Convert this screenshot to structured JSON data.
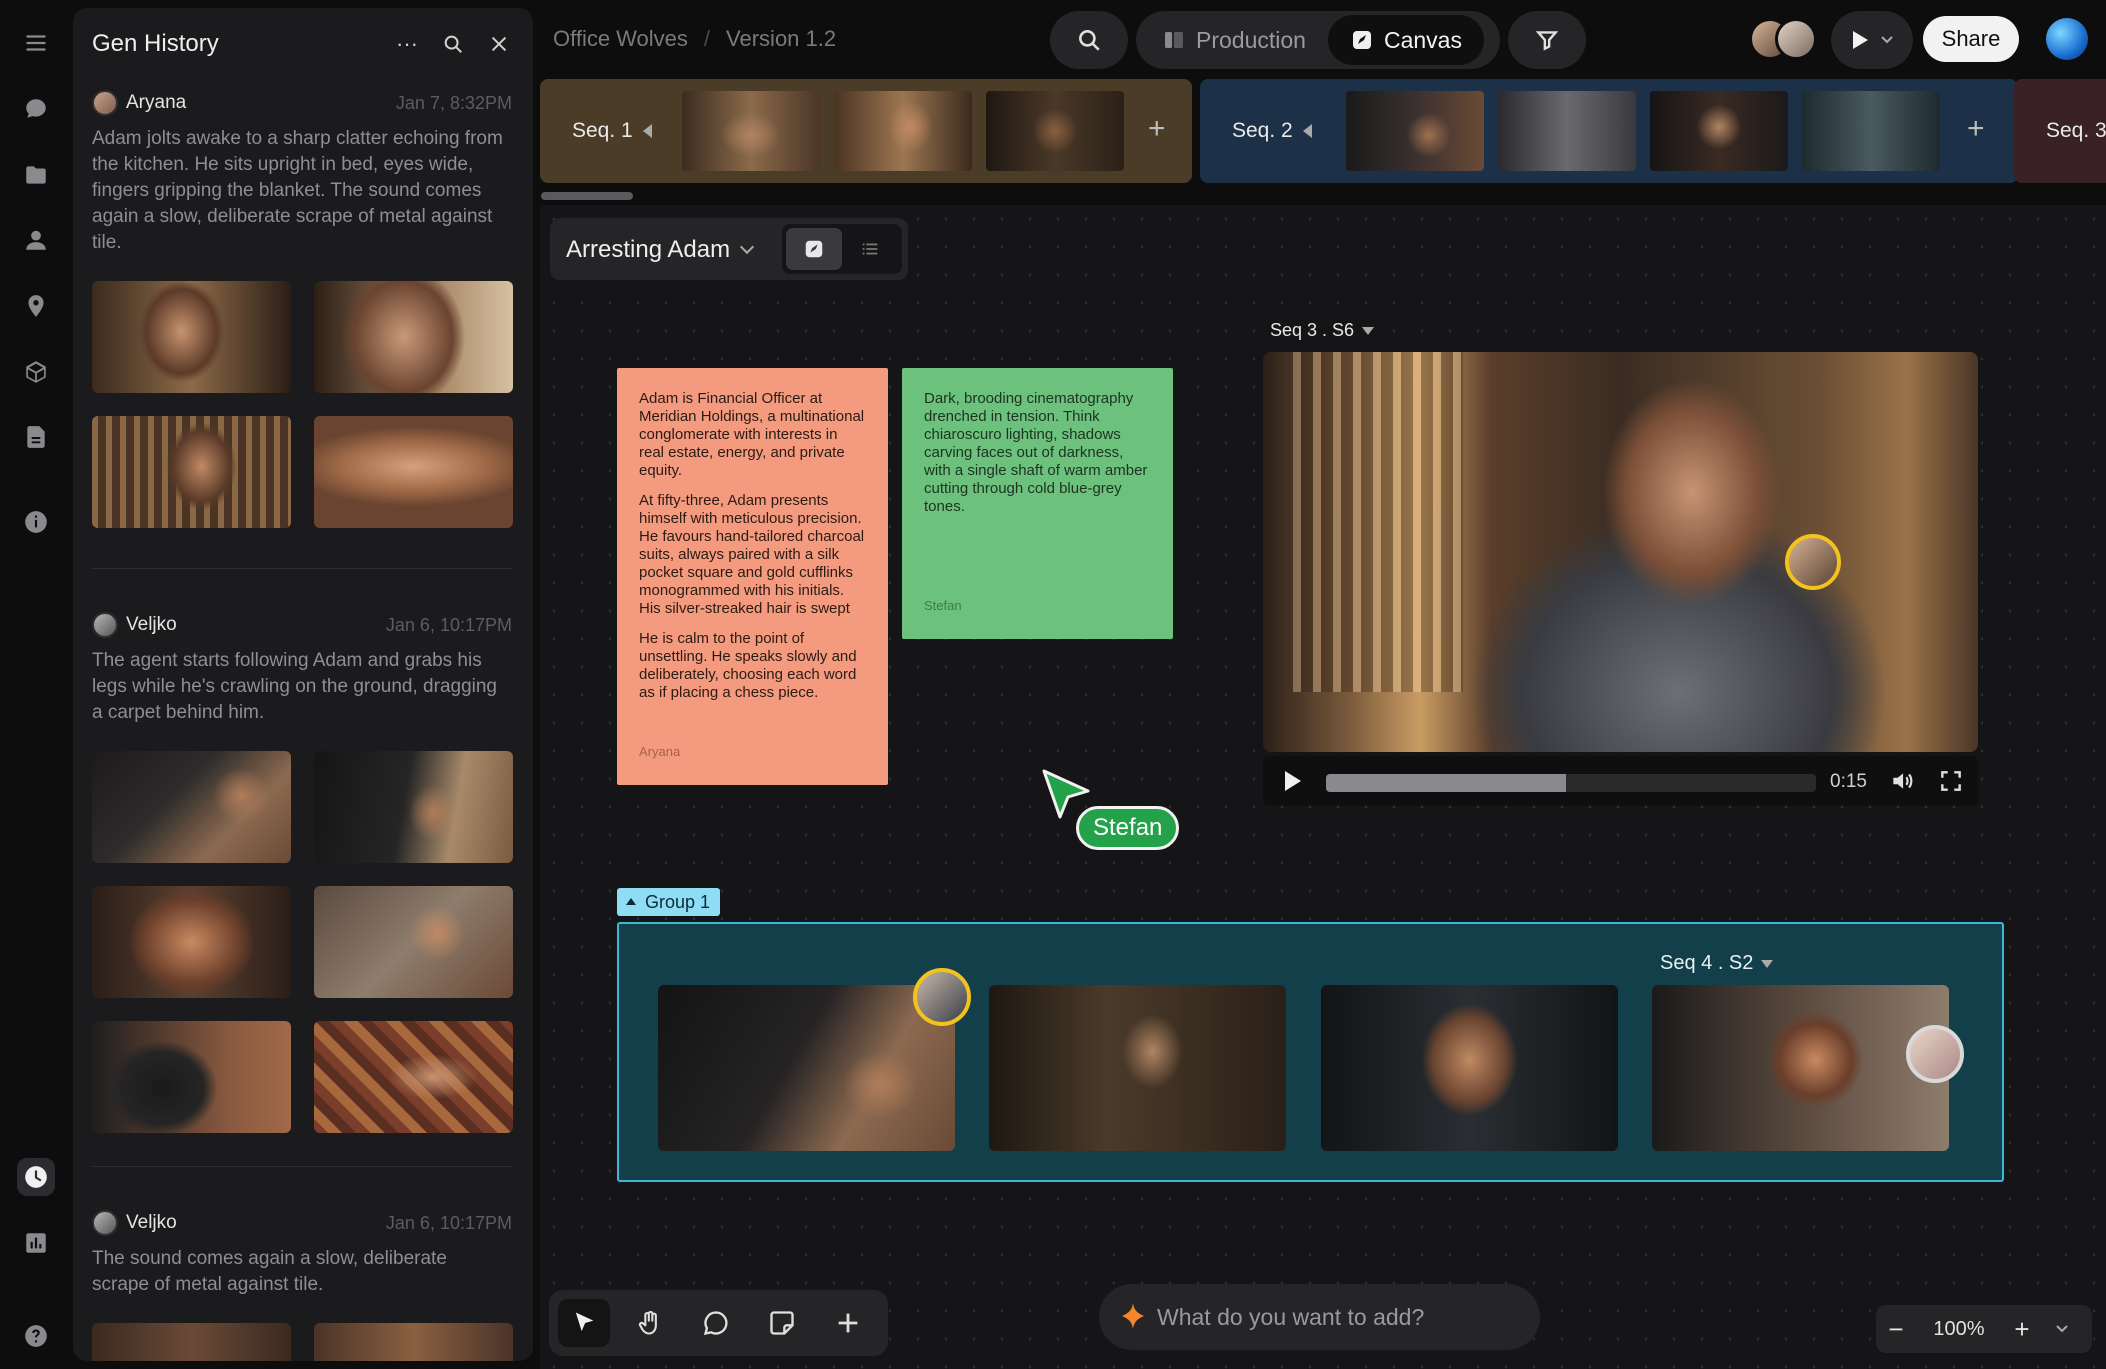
{
  "app": {
    "breadcrumb": {
      "project": "Office Wolves",
      "version": "Version 1.2"
    },
    "modes": [
      {
        "label": "Production"
      },
      {
        "label": "Canvas"
      }
    ],
    "share_label": "Share"
  },
  "rail": {
    "icons": [
      "menu-icon",
      "chat-icon",
      "folder-icon",
      "user-icon",
      "location-icon",
      "cube-icon",
      "document-icon",
      "info-icon",
      "history-icon",
      "chart-icon",
      "help-icon"
    ],
    "active": "history-icon"
  },
  "history": {
    "title": "Gen History",
    "entries": [
      {
        "user": "Aryana",
        "time": "Jan 7, 8:32PM",
        "text": "Adam jolts awake to a sharp clatter echoing from the kitchen. He sits upright in bed, eyes wide, fingers gripping the blanket. The sound comes again a slow, deliberate scrape of metal against tile."
      },
      {
        "user": "Veljko",
        "time": "Jan 6, 10:17PM",
        "text": "The agent starts following Adam and grabs his legs while he's crawling on the ground, dragging a carpet behind him."
      },
      {
        "user": "Veljko",
        "time": "Jan 6, 10:17PM",
        "text": "The sound comes again a slow, deliberate scrape of metal against tile."
      }
    ]
  },
  "sequences": [
    {
      "label": "Seq. 1",
      "color": "#4a3c27"
    },
    {
      "label": "Seq. 2",
      "color": "#1c3148"
    },
    {
      "label": "Seq. 3",
      "color": "#3a2126"
    }
  ],
  "board": {
    "title": "Arresting Adam"
  },
  "notes": {
    "orange": {
      "paragraphs": [
        "Adam is Financial Officer at Meridian Holdings, a multinational conglomerate with interests in real estate, energy, and private equity.",
        "At fifty-three, Adam presents himself with meticulous precision. He favours hand-tailored charcoal suits, always paired with a silk pocket square and gold cufflinks monogrammed with his initials. His silver-streaked hair is swept",
        "He is calm to the point of unsettling. He speaks slowly and deliberately, choosing each word as if placing a chess piece."
      ],
      "author": "Aryana"
    },
    "green": {
      "paragraphs": [
        "Dark, brooding cinematography drenched in tension. Think chiaroscuro lighting, shadows carving faces out of darkness, with a single shaft of warm amber cutting through cold blue-grey tones."
      ],
      "author": "Stefan"
    }
  },
  "video": {
    "label": "Seq 3 . S6",
    "time": "0:15",
    "progress": 0.49
  },
  "cursor": {
    "name": "Stefan",
    "color": "#24a24a"
  },
  "group": {
    "tag": "Group 1",
    "shot_label": "Seq 4 . S2"
  },
  "prompt": {
    "placeholder": "What do you want to add?"
  },
  "zoom": {
    "level": "100%"
  }
}
